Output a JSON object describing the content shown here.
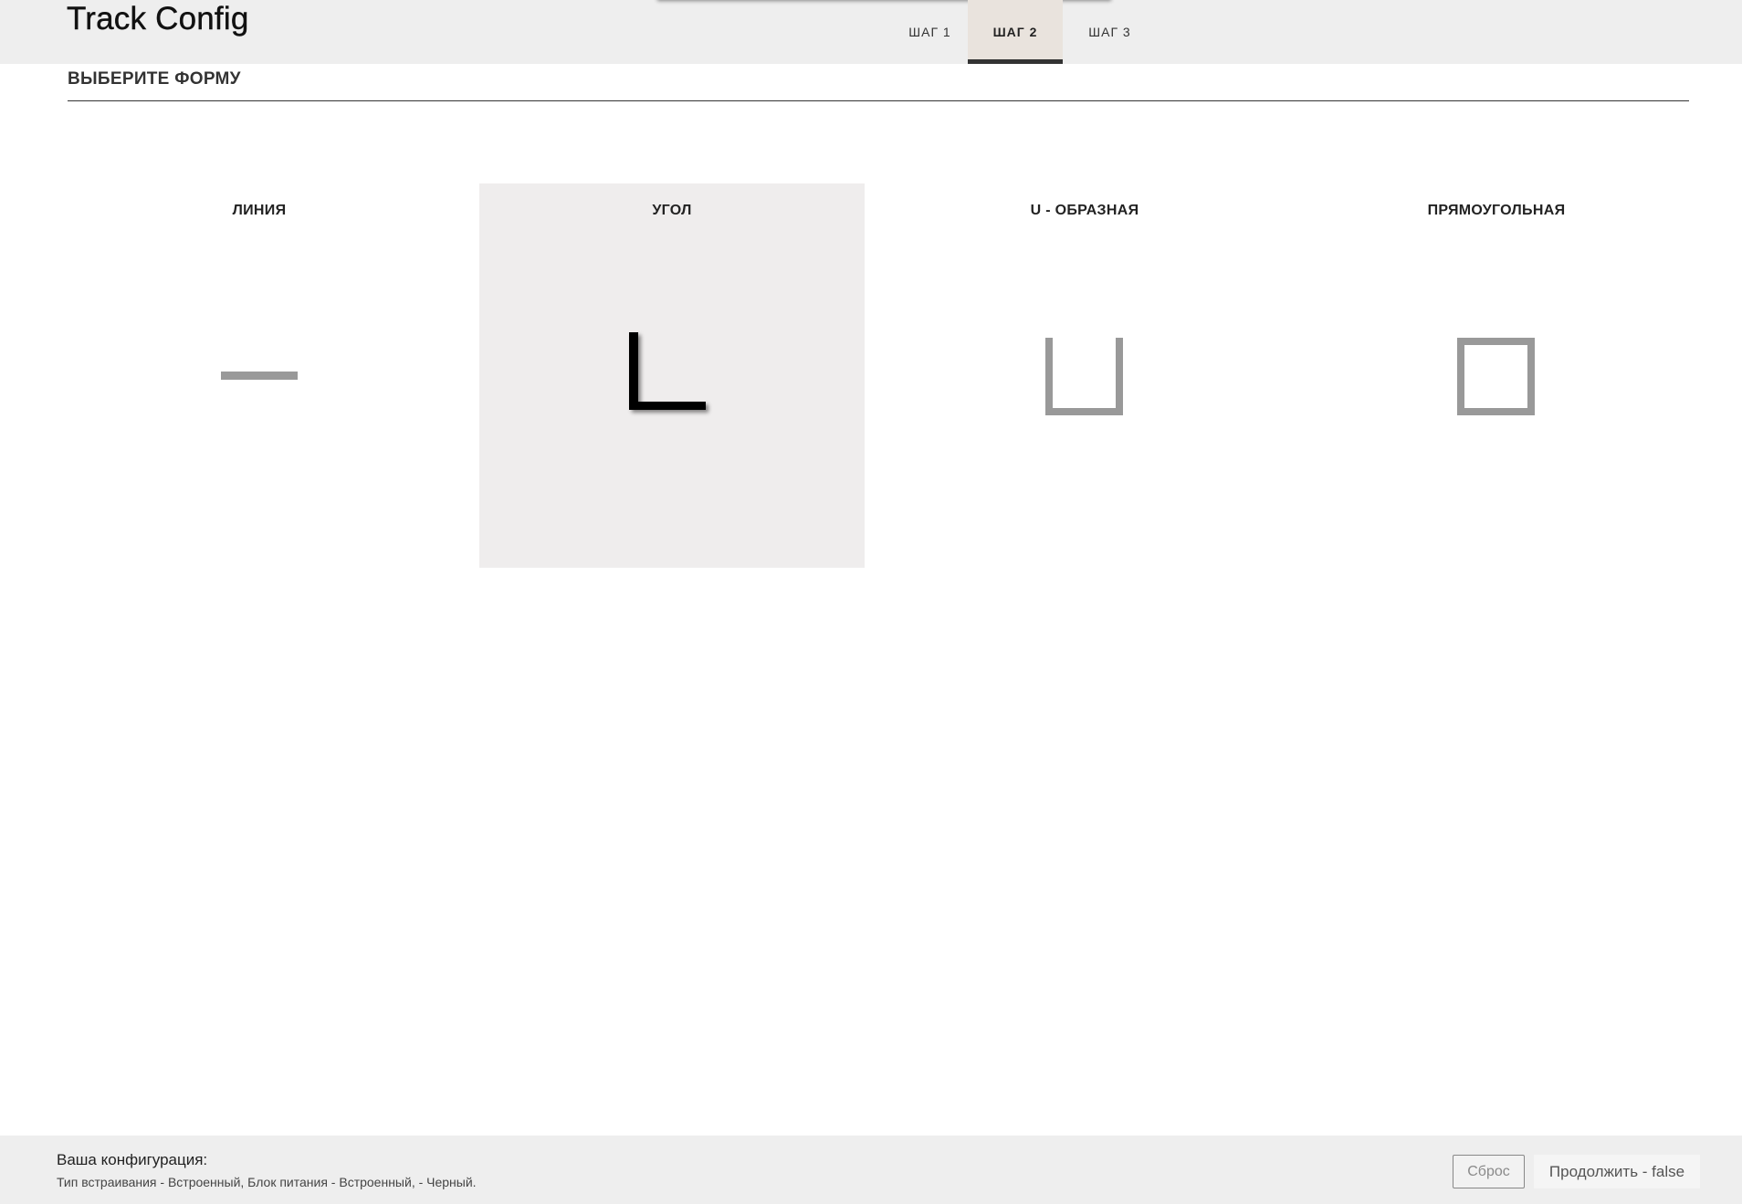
{
  "header": {
    "app_title": "Track Config",
    "tabs": [
      {
        "label": "ШАГ 1",
        "active": false
      },
      {
        "label": "ШАГ 2",
        "active": true
      },
      {
        "label": "ШАГ 3",
        "active": false
      }
    ]
  },
  "main": {
    "section_title": "ВЫБЕРИТЕ ФОРМУ",
    "options": [
      {
        "label": "ЛИНИЯ",
        "icon": "line-shape-icon",
        "selected": false
      },
      {
        "label": "УГОЛ",
        "icon": "corner-shape-icon",
        "selected": true
      },
      {
        "label": "U - ОБРАЗНАЯ",
        "icon": "u-shape-icon",
        "selected": false
      },
      {
        "label": "ПРЯМОУГОЛЬНАЯ",
        "icon": "rectangle-shape-icon",
        "selected": false
      }
    ]
  },
  "footer": {
    "config_title": "Ваша конфигурация:",
    "config_summary": "Тип встраивания - Встроенный, Блок питания - Встроенный, - Черный.",
    "reset_label": "Сброс",
    "continue_label": "Продолжить - false"
  },
  "colors": {
    "header_bg": "#eeeeee",
    "active_tab_bg": "#e9e3dd",
    "selected_option_bg": "#efeded",
    "icon_inactive": "#999999",
    "icon_active": "#000000"
  }
}
